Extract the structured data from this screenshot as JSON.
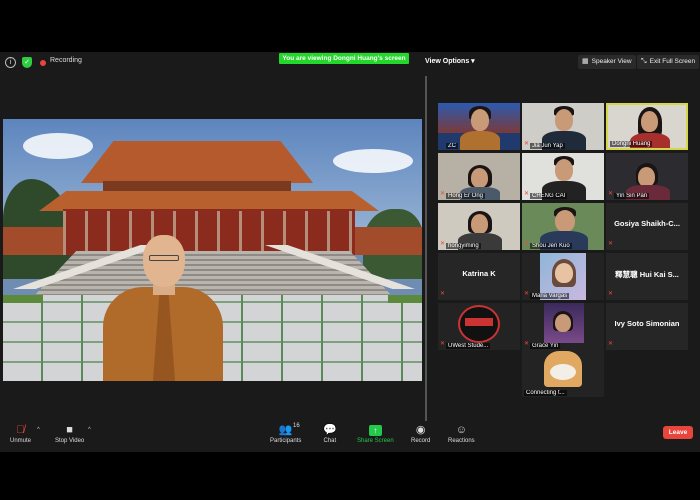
{
  "topbar": {
    "recording_label": "Recording",
    "viewing_banner": "You are viewing Dongni Huang's screen",
    "view_options_label": "View Options",
    "speaker_view_label": "Speaker View",
    "full_screen_label": "Exit Full Screen"
  },
  "gallery": [
    {
      "name": "ZC",
      "muted": false
    },
    {
      "name": "Jia Jun Yap",
      "muted": true
    },
    {
      "name": "Dongni Huang",
      "muted": false,
      "active": true
    },
    {
      "name": "Hong Er Ong",
      "muted": true
    },
    {
      "name": "CHENG CAI",
      "muted": true
    },
    {
      "name": "Yin Sin Pan",
      "muted": true
    },
    {
      "name": "hongyiming",
      "muted": true
    },
    {
      "name": "Shou Jen Kuo",
      "muted": true
    },
    {
      "name": "Gosiya Shaikh-C...",
      "muted": true,
      "video_off": true
    },
    {
      "name": "Katrina K",
      "muted": true,
      "video_off": true
    },
    {
      "name": "Maria Vargas",
      "muted": true
    },
    {
      "name": "釋慧聰 Hui Kai S...",
      "muted": true,
      "video_off": true
    },
    {
      "name": "UWest Stude...",
      "muted": true
    },
    {
      "name": "Grace Yin",
      "muted": true
    },
    {
      "name": "Ivy Soto Simonian",
      "muted": true,
      "video_off": true
    },
    {
      "name": "Connecting t...",
      "muted": false
    }
  ],
  "toolbar": {
    "unmute_label": "Unmute",
    "stop_video_label": "Stop Video",
    "participants_label": "Participants",
    "participants_count": "16",
    "chat_label": "Chat",
    "share_label": "Share Screen",
    "record_label": "Record",
    "reactions_label": "Reactions",
    "leave_label": "Leave"
  },
  "colors": {
    "banner": "#23d82a",
    "leave": "#e8453c",
    "active_border": "#d6d64a",
    "share": "#23c94a"
  }
}
